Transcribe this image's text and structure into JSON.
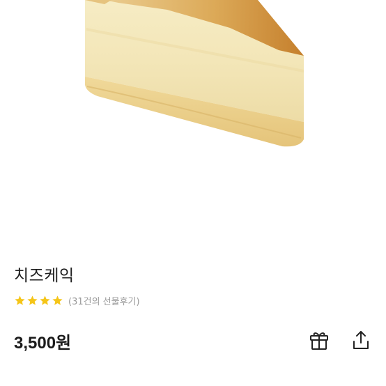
{
  "product": {
    "name": "치즈케익",
    "rating_stars": 4,
    "review_count_text": "(31건의 선물후기)",
    "price": "3,500원"
  },
  "icons": {
    "star": "star-icon",
    "gift": "gift-icon",
    "share": "share-icon"
  },
  "colors": {
    "star": "#F5C518",
    "text": "#222222",
    "muted": "#9a9a9a"
  }
}
